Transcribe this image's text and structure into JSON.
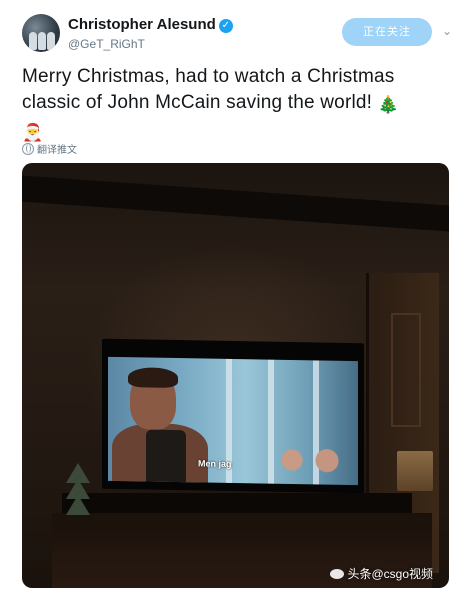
{
  "header": {
    "display_name": "Christopher Alesund",
    "verified_glyph": "✓",
    "handle": "@GeT_RiGhT",
    "follow_button_label": "正在关注",
    "menu_icon": "chevron-down-icon"
  },
  "tweet": {
    "text_line1": "Merry Christmas, had to watch a Christmas",
    "text_line2": "classic of John McCain saving the world!",
    "emoji_tree": "🎄",
    "emoji_santa": "🎅"
  },
  "translate": {
    "label": "翻译推文",
    "icon": "globe-icon"
  },
  "media": {
    "subtitle_text": "Men jag",
    "watermark_text": "头条@csgo视频"
  },
  "colors": {
    "accent": "#1da1f2",
    "follow_button_bg": "#9fd3f7",
    "secondary_text": "#657786"
  }
}
